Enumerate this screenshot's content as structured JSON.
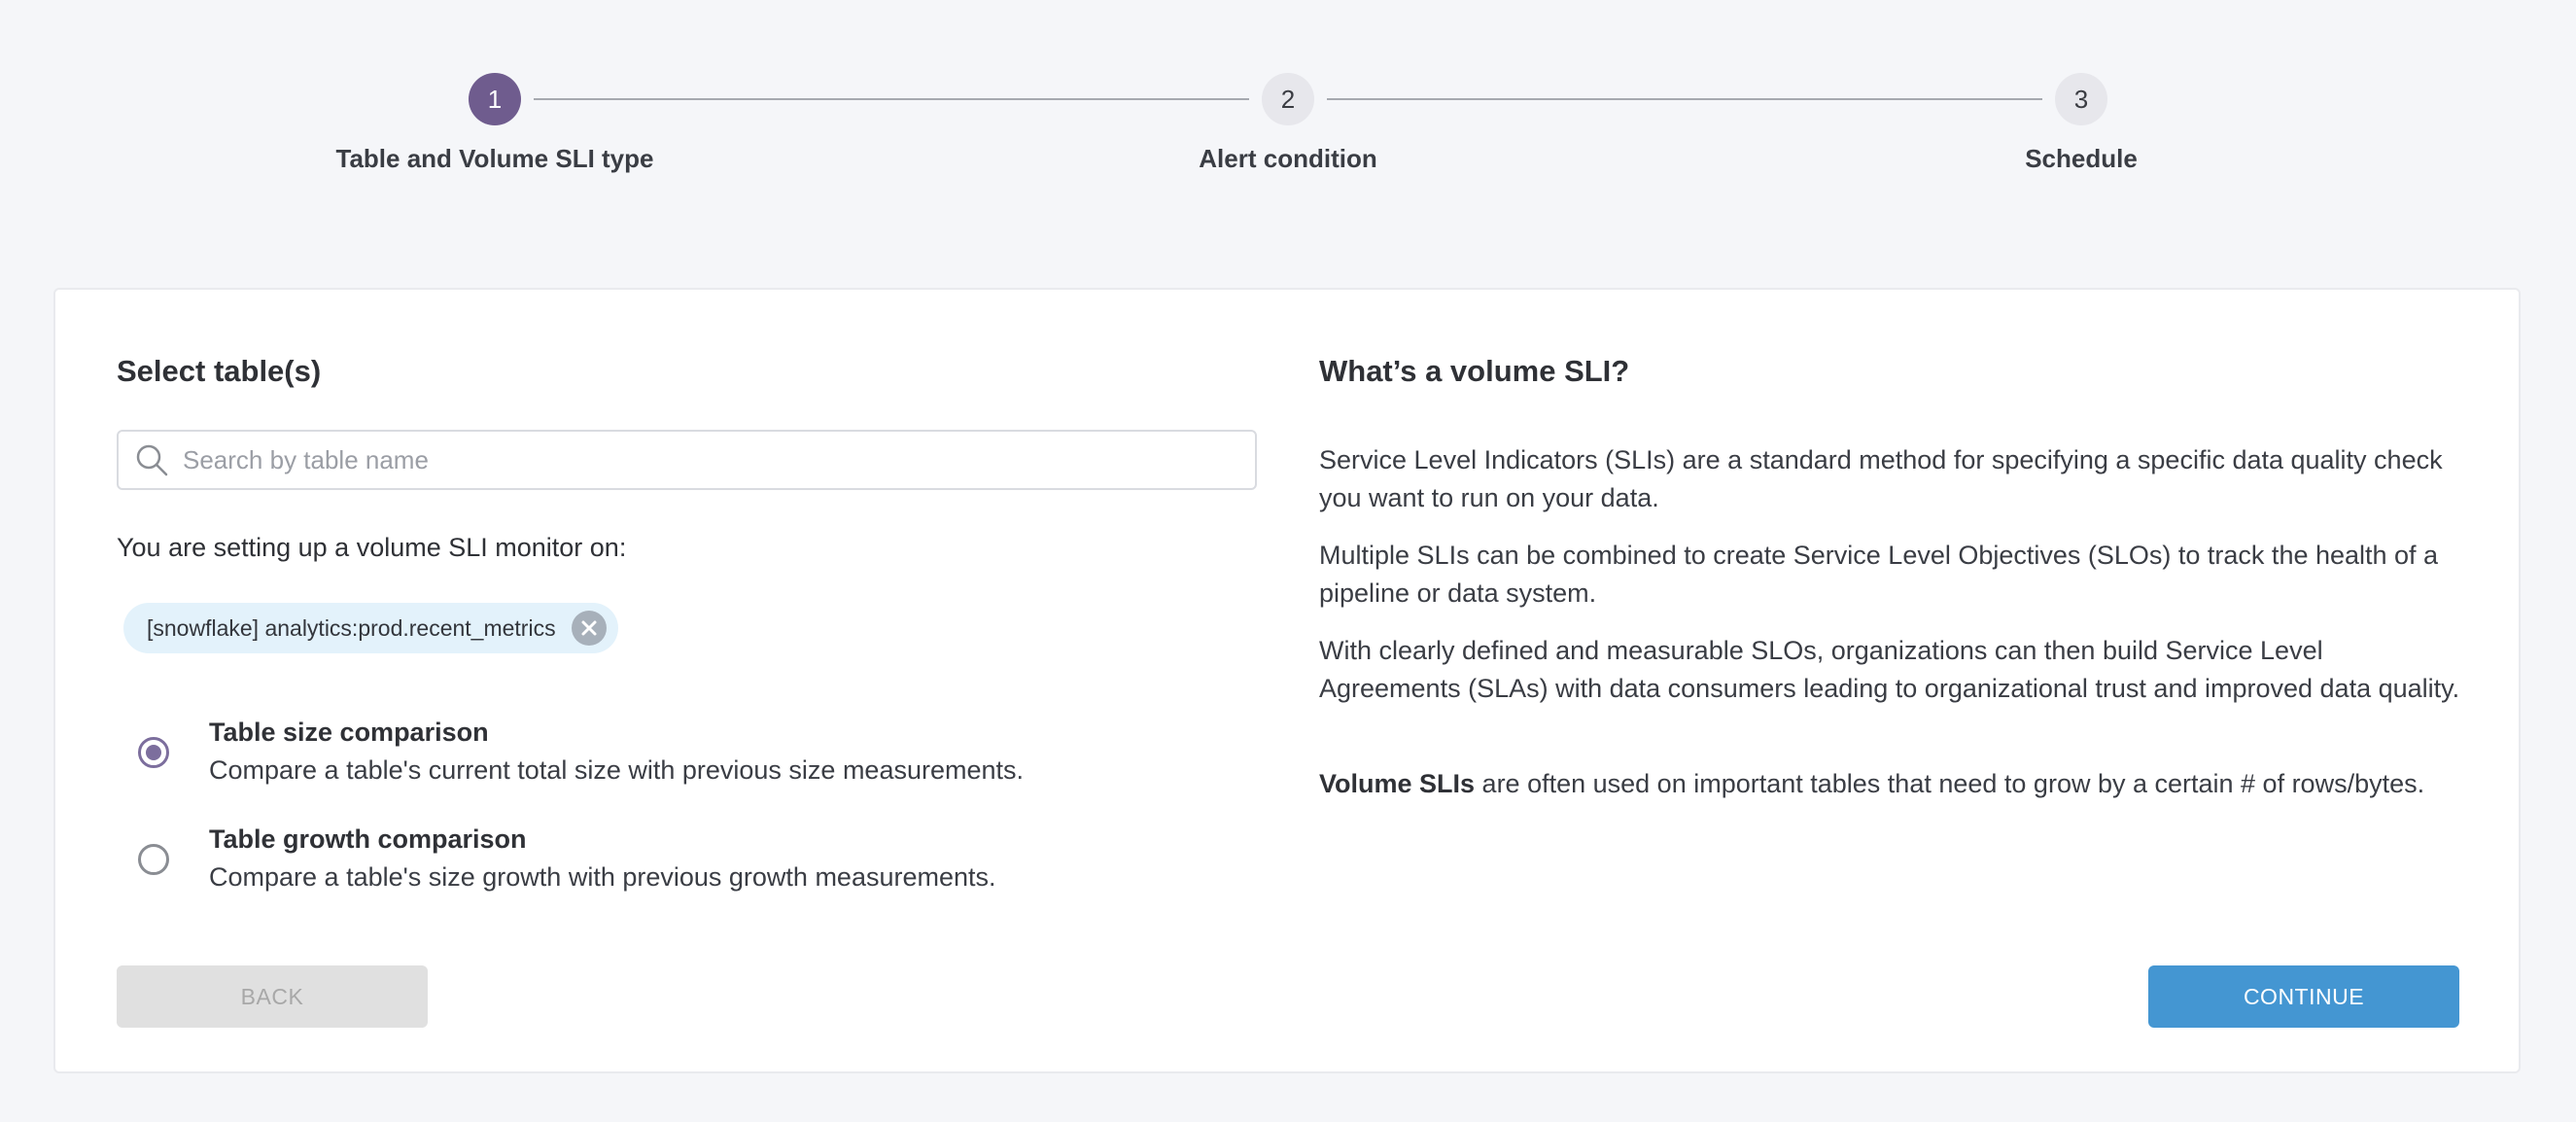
{
  "stepper": {
    "steps": [
      {
        "number": "1",
        "label": "Table and Volume SLI type",
        "active": true
      },
      {
        "number": "2",
        "label": "Alert condition",
        "active": false
      },
      {
        "number": "3",
        "label": "Schedule",
        "active": false
      }
    ]
  },
  "left": {
    "heading": "Select table(s)",
    "search": {
      "placeholder": "Search by table name",
      "value": "",
      "icon": "search-icon"
    },
    "setup_text": "You are setting up a volume SLI monitor on:",
    "selected_table": {
      "label": "[snowflake] analytics:prod.recent_metrics",
      "remove_icon": "close-circle-icon"
    },
    "options": [
      {
        "title": "Table size comparison",
        "description": "Compare a table's current total size with previous size measurements.",
        "selected": true
      },
      {
        "title": "Table growth comparison",
        "description": "Compare a table's size growth with previous growth measurements.",
        "selected": false
      }
    ]
  },
  "right": {
    "heading": "What’s a volume SLI?",
    "paragraphs": [
      "Service Level Indicators (SLIs) are a standard method for specifying a specific data quality check you want to run on your data.",
      "Multiple SLIs can be combined to create Service Level Objectives (SLOs) to track the health of a pipeline or data system.",
      "With clearly defined and measurable SLOs, organizations can then build Service Level Agreements (SLAs) with data consumers leading to organizational trust and improved data quality."
    ],
    "final_bold": "Volume SLIs",
    "final_rest": " are often used on important tables that need to grow by a certain # of rows/bytes."
  },
  "buttons": {
    "back": "BACK",
    "continue": "CONTINUE"
  },
  "colors": {
    "accent": "#6f5c8e",
    "primary_button": "#4496d2",
    "chip_bg": "#e3f2fb"
  }
}
